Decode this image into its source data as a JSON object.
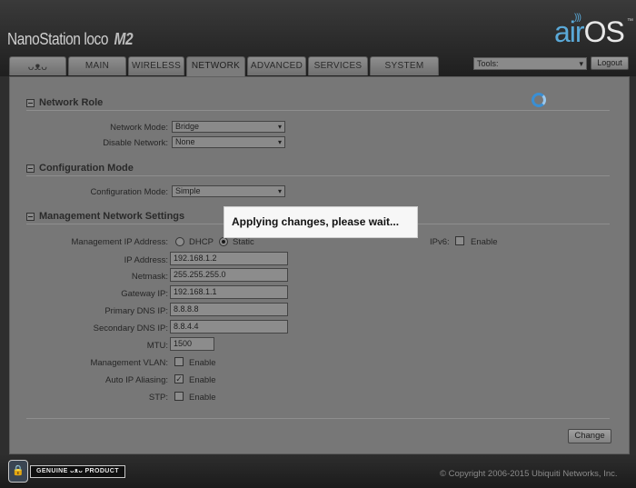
{
  "header": {
    "product_name": "NanoStation",
    "product_suffix": "loco",
    "product_model": "M2",
    "brand_air": "air",
    "brand_os": "OS",
    "brand_tm": "™"
  },
  "tabs": [
    {
      "label": "ᴗᴥᴗ",
      "icon": "ubiquiti-logo-icon"
    },
    {
      "label": "MAIN"
    },
    {
      "label": "WIRELESS"
    },
    {
      "label": "NETWORK",
      "active": true
    },
    {
      "label": "ADVANCED"
    },
    {
      "label": "SERVICES"
    },
    {
      "label": "SYSTEM"
    }
  ],
  "tools": {
    "selected": "Tools:",
    "options": [
      "Tools:"
    ]
  },
  "logout_label": "Logout",
  "network_role": {
    "title": "Network Role",
    "network_mode_label": "Network Mode:",
    "network_mode_value": "Bridge",
    "disable_network_label": "Disable Network:",
    "disable_network_value": "None"
  },
  "configuration_mode": {
    "title": "Configuration Mode",
    "label": "Configuration Mode:",
    "value": "Simple"
  },
  "management": {
    "title": "Management Network Settings",
    "ip_address_mode_label": "Management IP Address:",
    "dhcp_label": "DHCP",
    "static_label": "Static",
    "ip_mode": "Static",
    "ipv6_label": "IPv6:",
    "ipv6_enable_label": "Enable",
    "ipv6_enabled": false,
    "ip_address_label": "IP Address:",
    "ip_address": "192.168.1.2",
    "netmask_label": "Netmask:",
    "netmask": "255.255.255.0",
    "gateway_label": "Gateway IP:",
    "gateway": "192.168.1.1",
    "primary_dns_label": "Primary DNS IP:",
    "primary_dns": "8.8.8.8",
    "secondary_dns_label": "Secondary DNS IP:",
    "secondary_dns": "8.8.4.4",
    "mtu_label": "MTU:",
    "mtu": "1500",
    "vlan_label": "Management VLAN:",
    "vlan_enable_label": "Enable",
    "vlan_enabled": false,
    "auto_ip_label": "Auto IP Aliasing:",
    "auto_ip_enable_label": "Enable",
    "auto_ip_enabled": true,
    "stp_label": "STP:",
    "stp_enable_label": "Enable",
    "stp_enabled": false
  },
  "change_button_label": "Change",
  "footer": {
    "badge_left": "GENUINE",
    "badge_right": "PRODUCT",
    "copyright": "© Copyright 2006-2015 Ubiquiti Networks, Inc."
  },
  "overlay": {
    "message": "Applying changes, please wait...",
    "spinner_color": "#3a8fd4"
  },
  "colors": {
    "accent": "#5aa9d8",
    "header_bg": "#2e2e2e"
  }
}
